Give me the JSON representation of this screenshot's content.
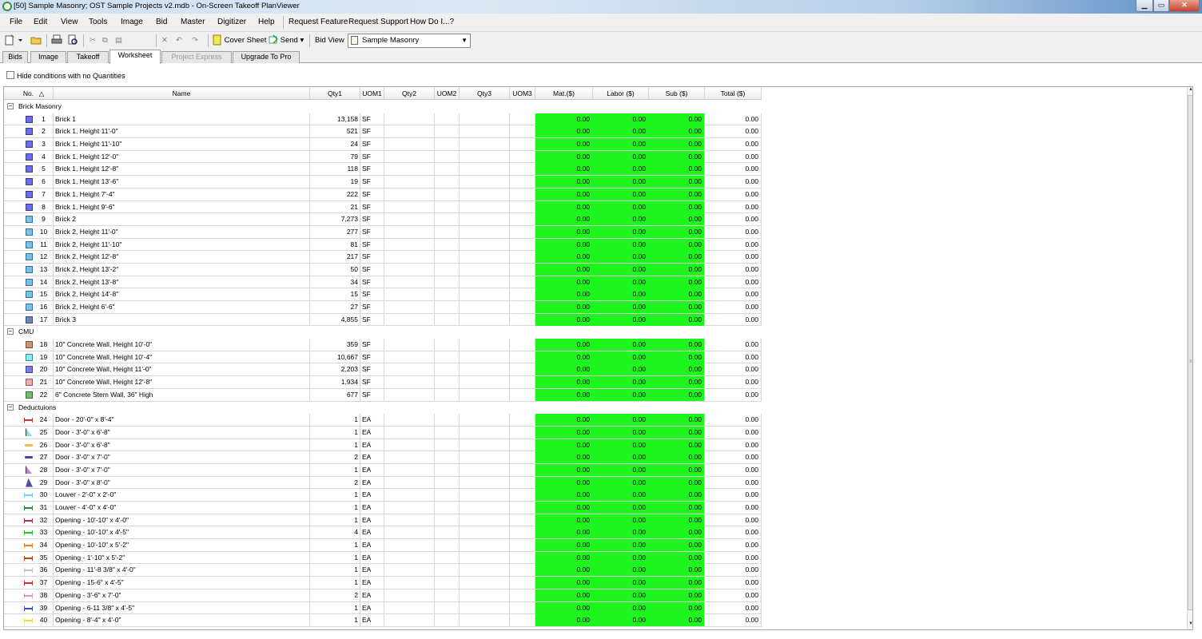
{
  "window": {
    "title": "[50] Sample Masonry; OST Sample Projects v2.mdb - On-Screen Takeoff PlanViewer",
    "controls": {
      "minimize": "▁",
      "maximize": "▭",
      "close": "✕"
    }
  },
  "menu": {
    "file": "File",
    "edit": "Edit",
    "view": "View",
    "tools": "Tools",
    "image": "Image",
    "bid": "Bid",
    "master": "Master",
    "digitizer": "Digitizer",
    "help": "Help",
    "request_feature": "Request Feature",
    "request_support": "Request Support",
    "how_do_i": "How Do I...?"
  },
  "toolbar": {
    "cover_sheet": "Cover Sheet",
    "send": "Send",
    "bid_view_label": "Bid View",
    "bid_view_value": "Sample Masonry"
  },
  "tabs": {
    "bids": "Bids",
    "image": "Image",
    "takeoff": "Takeoff",
    "worksheet": "Worksheet",
    "project_express": "Project Express",
    "upgrade": "Upgrade To Pro"
  },
  "options": {
    "hide_conditions": "Hide conditions with no Quantities"
  },
  "columns": {
    "no": "No.",
    "name": "Name",
    "qty1": "Qty1",
    "uom1": "UOM1",
    "qty2": "Qty2",
    "uom2": "UOM2",
    "qty3": "Qty3",
    "uom3": "UOM3",
    "mat": "Mat.($)",
    "labor": "Labor ($)",
    "sub": "Sub ($)",
    "total": "Total ($)"
  },
  "groups": [
    {
      "label": "Brick Masonry",
      "items": [
        {
          "no": "1",
          "name": "Brick 1",
          "qty1": "13,158",
          "uom1": "SF",
          "icon": "square-icon",
          "color": "#6b6bf0"
        },
        {
          "no": "2",
          "name": "Brick 1, Height 11'-0\"",
          "qty1": "521",
          "uom1": "SF",
          "icon": "square-icon",
          "color": "#6b6bf0"
        },
        {
          "no": "3",
          "name": "Brick 1, Height 11'-10\"",
          "qty1": "24",
          "uom1": "SF",
          "icon": "square-icon",
          "color": "#6b6bf0"
        },
        {
          "no": "4",
          "name": "Brick 1, Height 12'-0\"",
          "qty1": "79",
          "uom1": "SF",
          "icon": "square-icon",
          "color": "#6b6bf0"
        },
        {
          "no": "5",
          "name": "Brick 1, Height 12'-8\"",
          "qty1": "118",
          "uom1": "SF",
          "icon": "square-icon",
          "color": "#6b6bf0"
        },
        {
          "no": "6",
          "name": "Brick 1, Height 13'-6\"",
          "qty1": "19",
          "uom1": "SF",
          "icon": "square-icon",
          "color": "#6b6bf0"
        },
        {
          "no": "7",
          "name": "Brick 1, Height 7'-4\"",
          "qty1": "222",
          "uom1": "SF",
          "icon": "square-icon",
          "color": "#6b6bf0"
        },
        {
          "no": "8",
          "name": "Brick 1, Height 9'-6\"",
          "qty1": "21",
          "uom1": "SF",
          "icon": "square-icon",
          "color": "#6b6bf0"
        },
        {
          "no": "9",
          "name": "Brick 2",
          "qty1": "7,273",
          "uom1": "SF",
          "icon": "square-icon",
          "color": "#6fc3f5"
        },
        {
          "no": "10",
          "name": "Brick 2, Height 11'-0\"",
          "qty1": "277",
          "uom1": "SF",
          "icon": "square-icon",
          "color": "#6fc3f5"
        },
        {
          "no": "11",
          "name": "Brick 2, Height 11'-10\"",
          "qty1": "81",
          "uom1": "SF",
          "icon": "square-icon",
          "color": "#6fc3f5"
        },
        {
          "no": "12",
          "name": "Brick 2, Height 12'-8\"",
          "qty1": "217",
          "uom1": "SF",
          "icon": "square-icon",
          "color": "#6fc3f5"
        },
        {
          "no": "13",
          "name": "Brick 2, Height 13'-2\"",
          "qty1": "50",
          "uom1": "SF",
          "icon": "square-icon",
          "color": "#6fc3f5"
        },
        {
          "no": "14",
          "name": "Brick 2, Height 13'-8\"",
          "qty1": "34",
          "uom1": "SF",
          "icon": "square-icon",
          "color": "#6fc3f5"
        },
        {
          "no": "15",
          "name": "Brick 2, Height 14'-8\"",
          "qty1": "15",
          "uom1": "SF",
          "icon": "square-icon",
          "color": "#6fc3f5"
        },
        {
          "no": "16",
          "name": "Brick 2, Height 6'-6\"",
          "qty1": "27",
          "uom1": "SF",
          "icon": "square-icon",
          "color": "#6fc3f5"
        },
        {
          "no": "17",
          "name": "Brick 3",
          "qty1": "4,855",
          "uom1": "SF",
          "icon": "square-icon",
          "color": "#6a86c0"
        }
      ]
    },
    {
      "label": "CMU",
      "items": [
        {
          "no": "18",
          "name": "10\" Concrete Wall, Height 10'-0\"",
          "qty1": "359",
          "uom1": "SF",
          "icon": "square-icon",
          "color": "#d0906a"
        },
        {
          "no": "19",
          "name": "10\" Concrete Wall, Height 10'-4\"",
          "qty1": "10,667",
          "uom1": "SF",
          "icon": "square-icon",
          "color": "#7ff0f5"
        },
        {
          "no": "20",
          "name": "10\" Concrete Wall, Height 11'-0\"",
          "qty1": "2,203",
          "uom1": "SF",
          "icon": "square-icon",
          "color": "#7a7af5"
        },
        {
          "no": "21",
          "name": "10\" Concrete Wall, Height 12'-8\"",
          "qty1": "1,934",
          "uom1": "SF",
          "icon": "square-icon",
          "color": "#f5a8a8"
        },
        {
          "no": "22",
          "name": "6\" Concrete Stem Wall, 36\" High",
          "qty1": "677",
          "uom1": "SF",
          "icon": "square-icon",
          "color": "#6cbf6c"
        }
      ]
    },
    {
      "label": "Deductuions",
      "items": [
        {
          "no": "24",
          "name": "Door - 20'-0\" x 8'-4\"",
          "qty1": "1",
          "uom1": "EA",
          "icon": "line-icon",
          "color": "#c0392b"
        },
        {
          "no": "25",
          "name": "Door - 3'-0\" x 6'-8\"",
          "qty1": "1",
          "uom1": "EA",
          "icon": "door-icon",
          "color": "#7fe0f0"
        },
        {
          "no": "26",
          "name": "Door - 3'-0\" x 6'-8\"",
          "qty1": "1",
          "uom1": "EA",
          "icon": "bar-icon",
          "color": "#f0c040"
        },
        {
          "no": "27",
          "name": "Door - 3'-0\" x 7'-0\"",
          "qty1": "2",
          "uom1": "EA",
          "icon": "bar-icon",
          "color": "#4040c0"
        },
        {
          "no": "28",
          "name": "Door - 3'-0\" x 7'-0\"",
          "qty1": "1",
          "uom1": "EA",
          "icon": "door-icon",
          "color": "#c080e0"
        },
        {
          "no": "29",
          "name": "Door - 3'-0\" x 8'-0\"",
          "qty1": "2",
          "uom1": "EA",
          "icon": "tri-icon",
          "color": "#5050a0"
        },
        {
          "no": "30",
          "name": "Louver - 2'-0\" x 2'-0\"",
          "qty1": "1",
          "uom1": "EA",
          "icon": "line-icon",
          "color": "#80c8f0"
        },
        {
          "no": "31",
          "name": "Louver - 4'-0\" x 4'-0\"",
          "qty1": "1",
          "uom1": "EA",
          "icon": "line-icon",
          "color": "#2e8b2e"
        },
        {
          "no": "32",
          "name": "Opening - 10'-10\" x 4'-0\"",
          "qty1": "1",
          "uom1": "EA",
          "icon": "line-icon",
          "color": "#b03060"
        },
        {
          "no": "33",
          "name": "Opening - 10'-10\" x 4'-5\"",
          "qty1": "4",
          "uom1": "EA",
          "icon": "line-icon",
          "color": "#30c030"
        },
        {
          "no": "34",
          "name": "Opening - 10'-10\" x 5'-2\"",
          "qty1": "1",
          "uom1": "EA",
          "icon": "line-icon",
          "color": "#f08030"
        },
        {
          "no": "35",
          "name": "Opening - 1'-10\" x 5'-2\"",
          "qty1": "1",
          "uom1": "EA",
          "icon": "line-icon",
          "color": "#c04020"
        },
        {
          "no": "36",
          "name": "Opening - 11'-8 3/8\" x 4'-0\"",
          "qty1": "1",
          "uom1": "EA",
          "icon": "line-icon",
          "color": "#c0c0c0"
        },
        {
          "no": "37",
          "name": "Opening - 15-6\" x 4'-5\"",
          "qty1": "1",
          "uom1": "EA",
          "icon": "line-icon",
          "color": "#d03030"
        },
        {
          "no": "38",
          "name": "Opening - 3'-6\" x 7'-0\"",
          "qty1": "2",
          "uom1": "EA",
          "icon": "line-icon",
          "color": "#e090d0"
        },
        {
          "no": "39",
          "name": "Opening - 6-11 3/8\" x 4'-5\"",
          "qty1": "1",
          "uom1": "EA",
          "icon": "line-icon",
          "color": "#3050d0"
        },
        {
          "no": "40",
          "name": "Opening - 8'-4\" x 4'-0\"",
          "qty1": "1",
          "uom1": "EA",
          "icon": "line-icon",
          "color": "#e8e040"
        }
      ]
    }
  ],
  "money_value": "0.00",
  "colors": {
    "money_fill": "#1ef41e",
    "title_gradient_end": "#5d8fc7"
  }
}
